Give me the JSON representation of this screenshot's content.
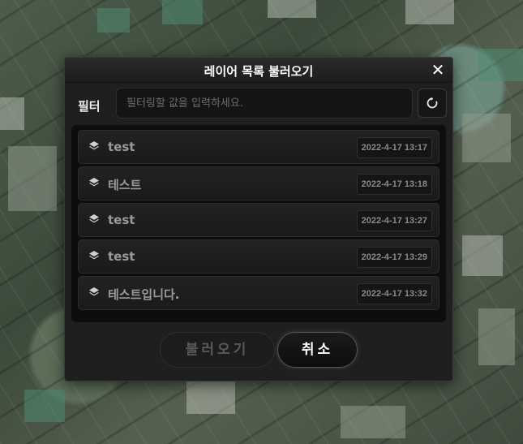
{
  "dialog": {
    "title": "레이어 목록 불러오기",
    "close_icon": "close-icon"
  },
  "filter": {
    "label": "필터",
    "placeholder": "필터링할 값을 입력하세요.",
    "value": "",
    "refresh_icon": "refresh-icon"
  },
  "layers": [
    {
      "name": "test",
      "date": "2022-4-17 13:17",
      "icon": "layers-icon"
    },
    {
      "name": "테스트",
      "date": "2022-4-17 13:18",
      "icon": "layers-icon"
    },
    {
      "name": "test",
      "date": "2022-4-17 13:27",
      "icon": "layers-icon"
    },
    {
      "name": "test",
      "date": "2022-4-17 13:29",
      "icon": "layers-icon"
    },
    {
      "name": "테스트입니다.",
      "date": "2022-4-17 13:32",
      "icon": "layers-icon"
    }
  ],
  "actions": {
    "load_label": "불러오기",
    "cancel_label": "취소"
  }
}
